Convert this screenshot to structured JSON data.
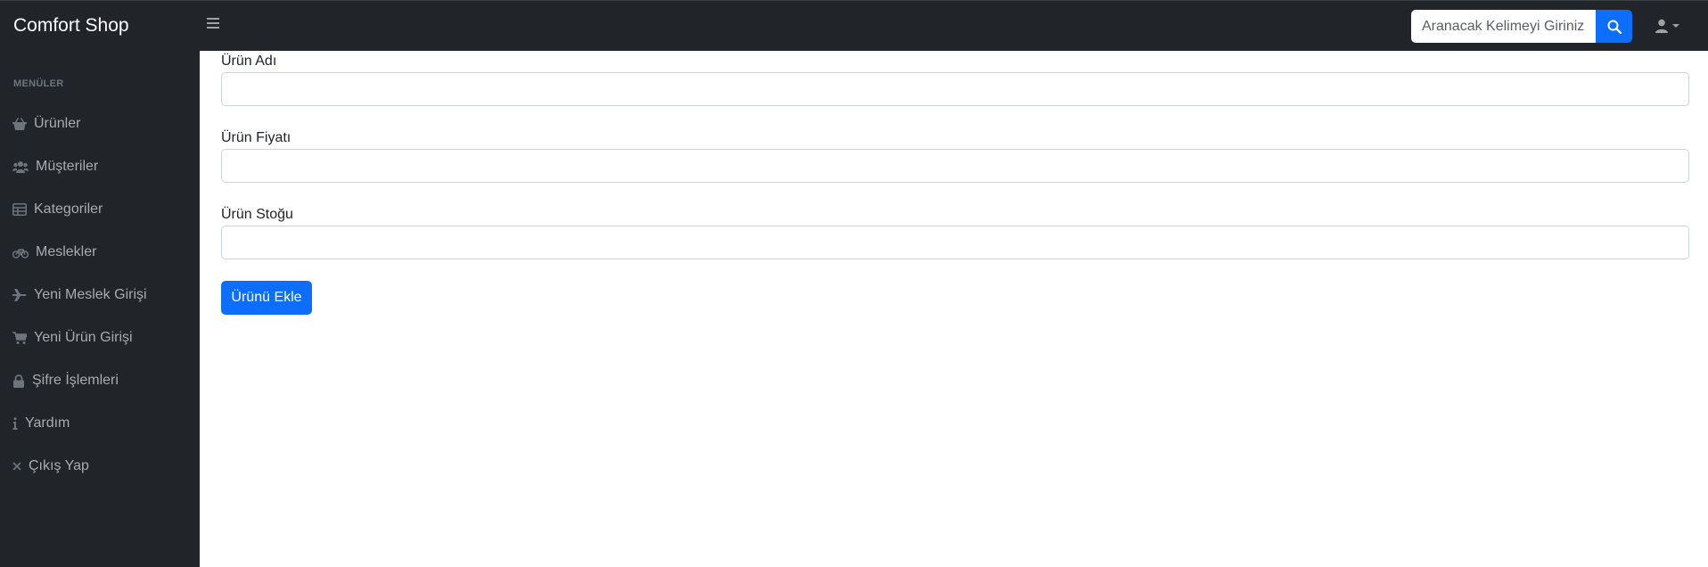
{
  "brand": "Comfort Shop",
  "search": {
    "placeholder": "Aranacak Kelimeyi Giriniz."
  },
  "sidebar": {
    "heading": "MENÜLER",
    "items": [
      {
        "label": "Ürünler",
        "icon": "basket-icon"
      },
      {
        "label": "Müşteriler",
        "icon": "users-icon"
      },
      {
        "label": "Kategoriler",
        "icon": "table-icon"
      },
      {
        "label": "Meslekler",
        "icon": "bicycle-icon"
      },
      {
        "label": "Yeni Meslek Girişi",
        "icon": "plane-icon"
      },
      {
        "label": "Yeni Ürün Girişi",
        "icon": "cart-icon"
      },
      {
        "label": "Şifre İşlemleri",
        "icon": "lock-icon"
      },
      {
        "label": "Yardım",
        "icon": "info-icon"
      },
      {
        "label": "Çıkış Yap",
        "icon": "close-icon"
      }
    ]
  },
  "form": {
    "fields": [
      {
        "label": "Ürün Adı",
        "value": ""
      },
      {
        "label": "Ürün Fiyatı",
        "value": ""
      },
      {
        "label": "Ürün Stoğu",
        "value": ""
      }
    ],
    "submit_label": "Ürünü Ekle"
  },
  "colors": {
    "nav_bg": "#212529",
    "accent": "#0d6efd",
    "sidebar_text": "#a7acb1"
  }
}
